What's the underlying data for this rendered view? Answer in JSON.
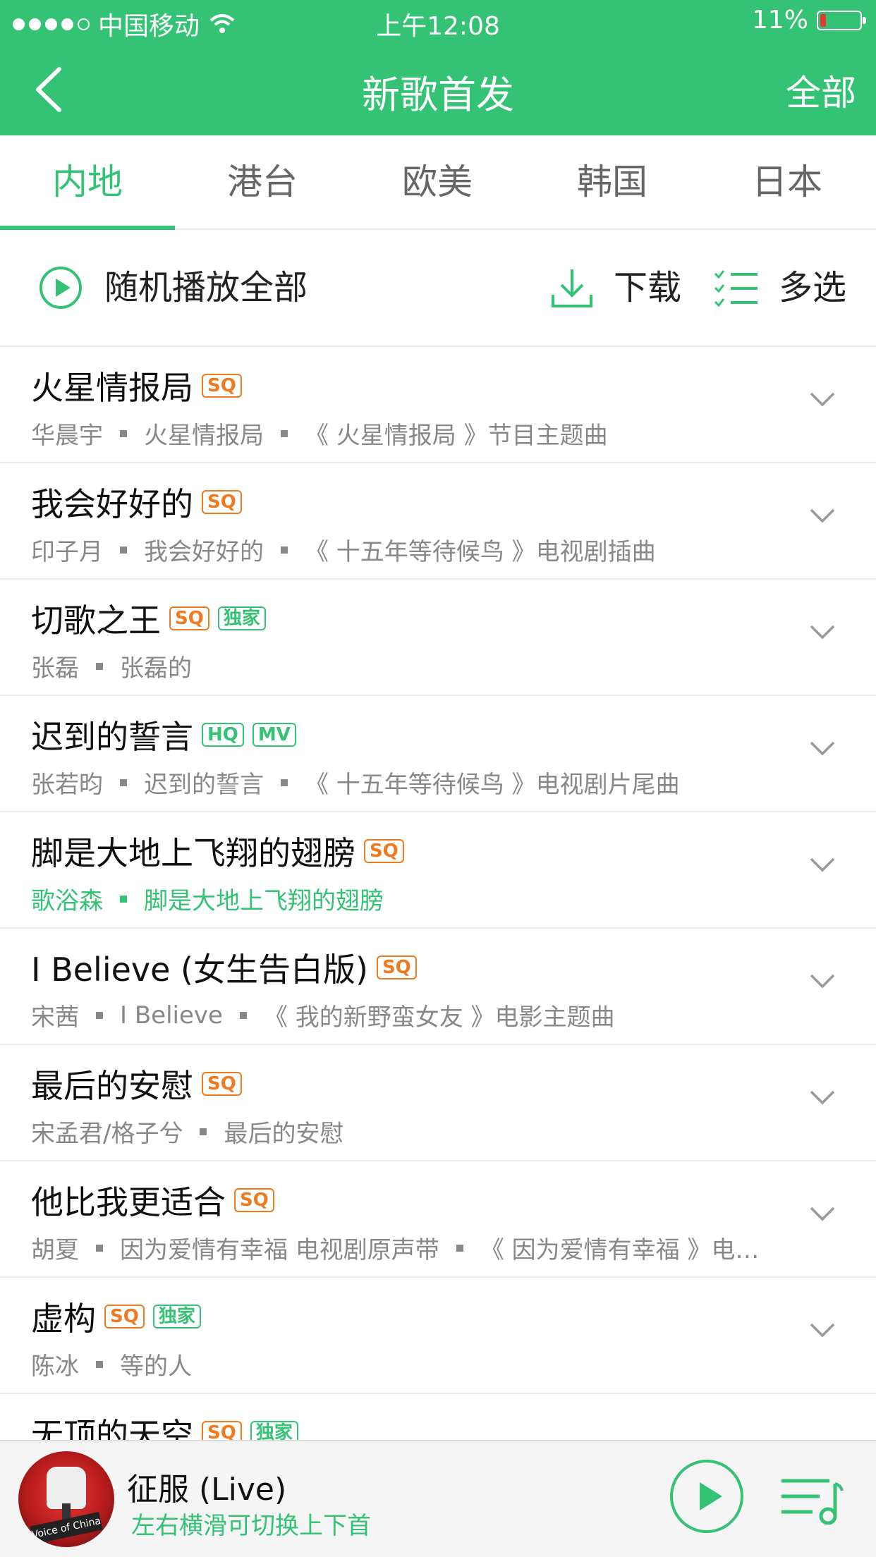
{
  "status_bar": {
    "carrier": "中国移动",
    "time": "上午12:08",
    "battery": "11%"
  },
  "nav": {
    "title": "新歌首发",
    "right_action": "全部"
  },
  "tabs": [
    {
      "label": "内地",
      "active": true
    },
    {
      "label": "港台",
      "active": false
    },
    {
      "label": "欧美",
      "active": false
    },
    {
      "label": "韩国",
      "active": false
    },
    {
      "label": "日本",
      "active": false
    }
  ],
  "actions": {
    "play_all": "随机播放全部",
    "download": "下载",
    "multi_select": "多选"
  },
  "songs": [
    {
      "title": "火星情报局",
      "badges": [
        "SQ"
      ],
      "artist": "华晨宇",
      "album": "火星情报局",
      "note": "《 火星情报局 》节目主题曲",
      "playing": false
    },
    {
      "title": "我会好好的",
      "badges": [
        "SQ"
      ],
      "artist": "印子月",
      "album": "我会好好的",
      "note": "《 十五年等待候鸟 》电视剧插曲",
      "playing": false
    },
    {
      "title": "切歌之王",
      "badges": [
        "SQ",
        "独家"
      ],
      "artist": "张磊",
      "album": "张磊的",
      "note": "",
      "playing": false
    },
    {
      "title": "迟到的誓言",
      "badges": [
        "HQ",
        "MV"
      ],
      "artist": "张若昀",
      "album": "迟到的誓言",
      "note": "《 十五年等待候鸟 》电视剧片尾曲",
      "playing": false
    },
    {
      "title": "脚是大地上飞翔的翅膀",
      "badges": [
        "SQ"
      ],
      "artist": "歌浴森",
      "album": "脚是大地上飞翔的翅膀",
      "note": "",
      "playing": true
    },
    {
      "title": "I Believe (女生告白版)",
      "badges": [
        "SQ"
      ],
      "artist": "宋茜",
      "album": "I Believe",
      "note": "《 我的新野蛮女友 》电影主题曲",
      "playing": false
    },
    {
      "title": "最后的安慰",
      "badges": [
        "SQ"
      ],
      "artist": "宋孟君/格子兮",
      "album": "最后的安慰",
      "note": "",
      "playing": false
    },
    {
      "title": "他比我更适合",
      "badges": [
        "SQ"
      ],
      "artist": "胡夏",
      "album": "因为爱情有幸福 电视剧原声带",
      "note": "《 因为爱情有幸福 》电…",
      "playing": false
    },
    {
      "title": "虚构",
      "badges": [
        "SQ",
        "独家"
      ],
      "artist": "陈冰",
      "album": "等的人",
      "note": "",
      "playing": false
    },
    {
      "title": "无顶的天空",
      "badges": [
        "SQ",
        "独家"
      ],
      "artist": "",
      "album": "",
      "note": "",
      "playing": false
    }
  ],
  "now_playing": {
    "title": "征服 (Live)",
    "hint": "左右横滑可切换上下首",
    "cover_text": "Voice of China"
  },
  "colors": {
    "brand_green": "#34c274",
    "sq_orange": "#f07a20"
  }
}
